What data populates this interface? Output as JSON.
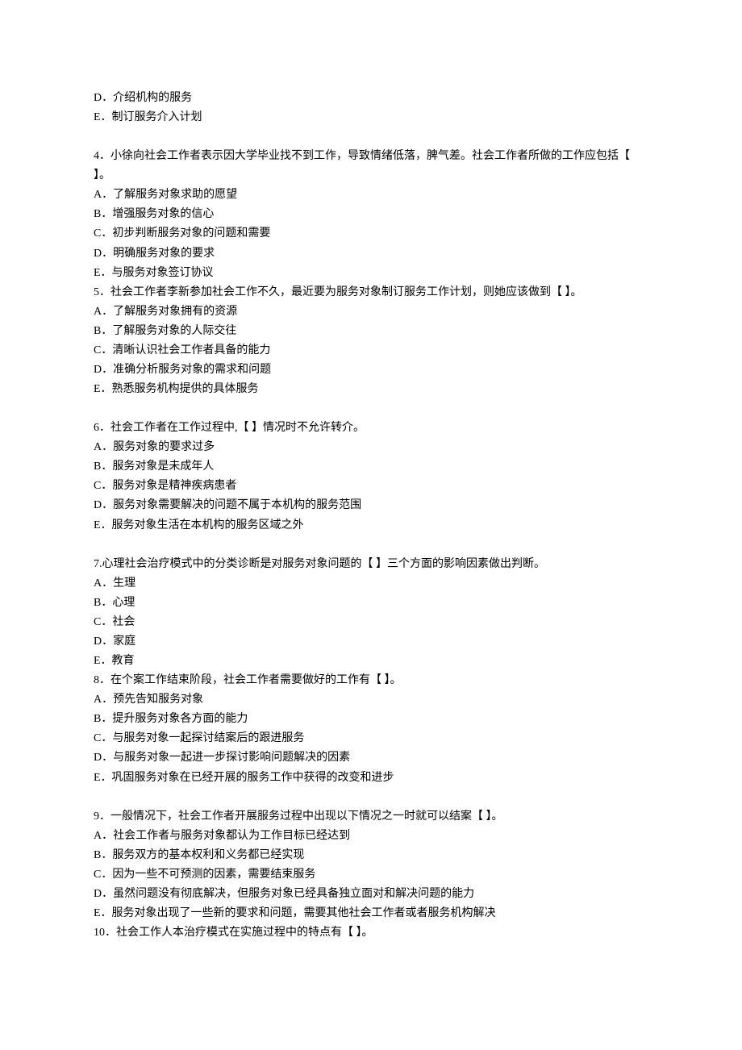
{
  "lines": [
    "D．介绍机构的服务",
    "E．制订服务介入计划",
    "",
    "4．小徐向社会工作者表示因大学毕业找不到工作，导致情绪低落，脾气差。社会工作者所做的工作应包括【 】。",
    "A．了解服务对象求助的愿望",
    "B．增强服务对象的信心",
    "C．初步判断服务对象的问题和需要",
    "D．明确服务对象的要求",
    "E．与服务对象签订协议",
    "5．社会工作者李新参加社会工作不久，最近要为服务对象制订服务工作计划，则她应该做到【 】。",
    "A．了解服务对象拥有的资源",
    "B．了解服务对象的人际交往",
    "C．清晰认识社会工作者具备的能力",
    "D．准确分析服务对象的需求和问题",
    "E．熟悉服务机构提供的具体服务",
    "",
    "6．社会工作者在工作过程中,【 】情况时不允许转介。",
    "A．服务对象的要求过多",
    "B．服务对象是未成年人",
    "C．服务对象是精神疾病患者",
    "D．服务对象需要解决的问题不属于本机构的服务范围",
    "E．服务对象生活在本机构的服务区域之外",
    "",
    "7.心理社会治疗模式中的分类诊断是对服务对象问题的【 】三个方面的影响因素做出判断。",
    "A．生理",
    "B．心理",
    "C．社会",
    "D．家庭",
    "E．教育",
    "8．在个案工作结束阶段，社会工作者需要做好的工作有【 】。",
    "A．预先告知服务对象",
    "B．提升服务对象各方面的能力",
    "C．与服务对象一起探讨结案后的跟进服务",
    "D．与服务对象一起进一步探讨影响问题解决的因素",
    "E．巩固服务对象在已经开展的服务工作中获得的改变和进步",
    "",
    "9．一般情况下，社会工作者开展服务过程中出现以下情况之一时就可以结案【 】。",
    "A．社会工作者与服务对象都认为工作目标已经达到",
    "B．服务双方的基本权利和义务都已经实现",
    "C．因为一些不可预测的因素，需要结束服务",
    "D．虽然问题没有彻底解决，但服务对象已经具备独立面对和解决问题的能力",
    "E．服务对象出现了一些新的要求和问题，需要其他社会工作者或者服务机构解决",
    "10．社会工作人本治疗模式在实施过程中的特点有【 】。"
  ]
}
